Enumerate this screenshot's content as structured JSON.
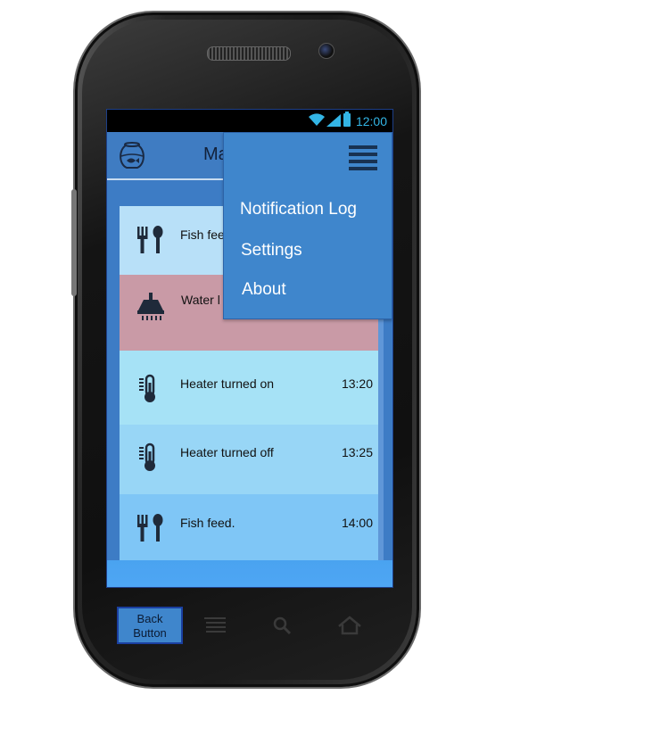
{
  "status_bar": {
    "time": "12:00"
  },
  "app_bar": {
    "title": "Ma",
    "bowl_icon": "fishbowl-icon"
  },
  "menu": {
    "icon": "hamburger-icon",
    "items": [
      {
        "label": "Notification Log"
      },
      {
        "label": "Settings"
      },
      {
        "label": "About"
      }
    ]
  },
  "notifications": [
    {
      "label": "Fish fee",
      "time": "",
      "icon": "fork-spoon-icon",
      "color": "#b8e0f8"
    },
    {
      "label": "Water l",
      "time": "",
      "icon": "shower-icon",
      "color": "#c99aa6"
    },
    {
      "label": "Heater turned on",
      "time": "13:20",
      "icon": "thermometer-icon",
      "color": "#a6e2f6"
    },
    {
      "label": "Heater turned off",
      "time": "13:25",
      "icon": "thermometer-icon",
      "color": "#98d6f6"
    },
    {
      "label": "Fish feed.",
      "time": "14:00",
      "icon": "fork-spoon-icon",
      "color": "#7fc6f6"
    }
  ],
  "softkeys": {
    "back_label": "Back Button",
    "recent_icon": "recent-apps-icon",
    "search_icon": "search-icon",
    "home_icon": "home-icon"
  },
  "colors": {
    "accent": "#3f86cc",
    "status_text": "#33b5e5"
  }
}
